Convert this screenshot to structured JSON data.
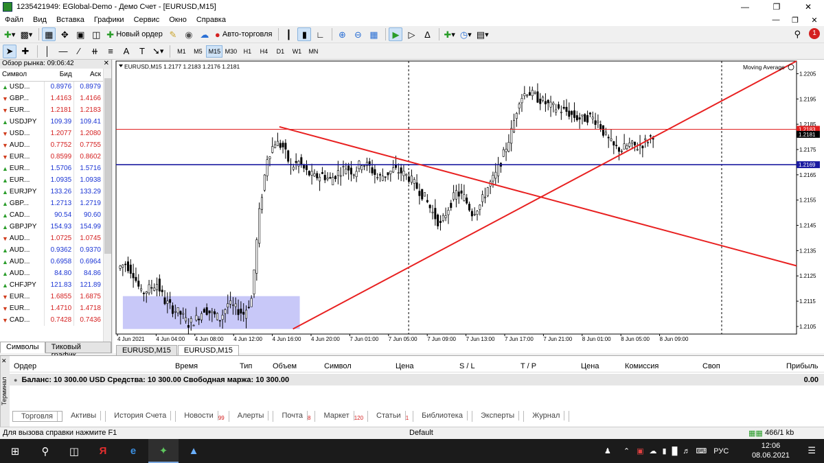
{
  "window": {
    "title": "1235421949: EGlobal-Demo - Демо Счет - [EURUSD,M15]"
  },
  "menu": [
    "Файл",
    "Вид",
    "Вставка",
    "Графики",
    "Сервис",
    "Окно",
    "Справка"
  ],
  "toolbar": {
    "new_order": "Новый ордер",
    "auto_trading": "Авто-торговля",
    "notification_count": "1"
  },
  "timeframes": [
    "M1",
    "M5",
    "M15",
    "M30",
    "H1",
    "H4",
    "D1",
    "W1",
    "MN"
  ],
  "active_timeframe": "M15",
  "market_watch": {
    "title": "Обзор рынка: 09:06:42",
    "columns": [
      "Символ",
      "Бид",
      "Аск"
    ],
    "rows": [
      {
        "symbol": "USD...",
        "bid": "0.8976",
        "ask": "0.8979",
        "dir": "up",
        "color": "blue"
      },
      {
        "symbol": "GBP...",
        "bid": "1.4163",
        "ask": "1.4166",
        "dir": "down",
        "color": "red"
      },
      {
        "symbol": "EUR...",
        "bid": "1.2181",
        "ask": "1.2183",
        "dir": "down",
        "color": "red"
      },
      {
        "symbol": "USDJPY",
        "bid": "109.39",
        "ask": "109.41",
        "dir": "up",
        "color": "blue"
      },
      {
        "symbol": "USD...",
        "bid": "1.2077",
        "ask": "1.2080",
        "dir": "down",
        "color": "red"
      },
      {
        "symbol": "AUD...",
        "bid": "0.7752",
        "ask": "0.7755",
        "dir": "down",
        "color": "red"
      },
      {
        "symbol": "EUR...",
        "bid": "0.8599",
        "ask": "0.8602",
        "dir": "down",
        "color": "red"
      },
      {
        "symbol": "EUR...",
        "bid": "1.5706",
        "ask": "1.5716",
        "dir": "up",
        "color": "blue"
      },
      {
        "symbol": "EUR...",
        "bid": "1.0935",
        "ask": "1.0938",
        "dir": "up",
        "color": "blue"
      },
      {
        "symbol": "EURJPY",
        "bid": "133.26",
        "ask": "133.29",
        "dir": "up",
        "color": "blue"
      },
      {
        "symbol": "GBP...",
        "bid": "1.2713",
        "ask": "1.2719",
        "dir": "up",
        "color": "blue"
      },
      {
        "symbol": "CAD...",
        "bid": "90.54",
        "ask": "90.60",
        "dir": "up",
        "color": "blue"
      },
      {
        "symbol": "GBPJPY",
        "bid": "154.93",
        "ask": "154.99",
        "dir": "up",
        "color": "blue"
      },
      {
        "symbol": "AUD...",
        "bid": "1.0725",
        "ask": "1.0745",
        "dir": "down",
        "color": "red"
      },
      {
        "symbol": "AUD...",
        "bid": "0.9362",
        "ask": "0.9370",
        "dir": "up",
        "color": "blue"
      },
      {
        "symbol": "AUD...",
        "bid": "0.6958",
        "ask": "0.6964",
        "dir": "up",
        "color": "blue"
      },
      {
        "symbol": "AUD...",
        "bid": "84.80",
        "ask": "84.86",
        "dir": "up",
        "color": "blue"
      },
      {
        "symbol": "CHFJPY",
        "bid": "121.83",
        "ask": "121.89",
        "dir": "up",
        "color": "blue"
      },
      {
        "symbol": "EUR...",
        "bid": "1.6855",
        "ask": "1.6875",
        "dir": "down",
        "color": "red"
      },
      {
        "symbol": "EUR...",
        "bid": "1.4710",
        "ask": "1.4718",
        "dir": "down",
        "color": "red"
      },
      {
        "symbol": "CAD...",
        "bid": "0.7428",
        "ask": "0.7436",
        "dir": "down",
        "color": "red"
      }
    ],
    "tabs": [
      "Символы",
      "Тиковый график"
    ],
    "active_tab": "Символы"
  },
  "chart": {
    "header": "EURUSD,M15  1.2177 1.2183 1.2176 1.2181",
    "indicator_label": "Moving Average",
    "tabs": [
      "EURUSD,M15",
      "EURUSD,M15"
    ],
    "active_tab_index": 1
  },
  "chart_data": {
    "type": "candlestick",
    "symbol": "EURUSD",
    "timeframe": "M15",
    "last_ohlc": {
      "open": 1.2177,
      "high": 1.2183,
      "low": 1.2176,
      "close": 1.2181
    },
    "y_ticks": [
      "1.2205",
      "1.2195",
      "1.2185",
      "1.2175",
      "1.2165",
      "1.2155",
      "1.2145",
      "1.2135",
      "1.2125",
      "1.2115",
      "1.2105"
    ],
    "ylim": [
      1.2102,
      1.221
    ],
    "x_ticks": [
      "4 Jun 2021",
      "4 Jun 04:00",
      "4 Jun 08:00",
      "4 Jun 12:00",
      "4 Jun 16:00",
      "4 Jun 20:00",
      "7 Jun 01:00",
      "7 Jun 05:00",
      "7 Jun 09:00",
      "7 Jun 13:00",
      "7 Jun 17:00",
      "7 Jun 21:00",
      "8 Jun 01:00",
      "8 Jun 05:00",
      "8 Jun 09:00"
    ],
    "price_labels": {
      "ask": "1.2183",
      "bid": "1.2181",
      "hline": "1.2169"
    },
    "horizontal_lines": [
      {
        "value": 1.2183,
        "color": "#e02020"
      },
      {
        "value": 1.2169,
        "color": "#1a1aa0"
      }
    ],
    "trendlines": [
      {
        "from": {
          "xi": 0.26,
          "y": 1.2104
        },
        "to": {
          "xi": 1.0,
          "y": 1.221
        },
        "color": "#e82020"
      },
      {
        "from": {
          "xi": 0.24,
          "y": 1.2184
        },
        "to": {
          "xi": 1.0,
          "y": 1.2129
        },
        "color": "#e82020"
      }
    ],
    "rectangle": {
      "x0": 0.01,
      "x1": 0.27,
      "y0": 1.2104,
      "y1": 1.2117,
      "color": "#c8c8f8"
    },
    "candles_path": [
      1.2128,
      1.213,
      1.2126,
      1.2118,
      1.212,
      1.2122,
      1.2115,
      1.2112,
      1.211,
      1.2106,
      1.2108,
      1.2112,
      1.211,
      1.2108,
      1.2114,
      1.2112,
      1.211,
      1.2116,
      1.215,
      1.2172,
      1.2178,
      1.2176,
      1.2168,
      1.217,
      1.2166,
      1.2164,
      1.2165,
      1.2163,
      1.2166,
      1.2168,
      1.2166,
      1.217,
      1.2168,
      1.2164,
      1.2165,
      1.2167,
      1.2166,
      1.2164,
      1.216,
      1.2156,
      1.215,
      1.2145,
      1.2152,
      1.2158,
      1.2156,
      1.215,
      1.2153,
      1.216,
      1.2165,
      1.2173,
      1.2182,
      1.2195,
      1.2198,
      1.2196,
      1.2194,
      1.2192,
      1.2191,
      1.219,
      1.2188,
      1.2187,
      1.2188,
      1.2186,
      1.218,
      1.2176,
      1.2175,
      1.2177,
      1.2176,
      1.2178,
      1.2181
    ]
  },
  "terminal": {
    "label": "Терминал",
    "columns": [
      "Ордер",
      "Время",
      "Тип",
      "Объем",
      "Символ",
      "Цена",
      "S / L",
      "T / P",
      "Цена",
      "Комиссия",
      "Своп",
      "Прибыль"
    ],
    "balance_line": "Баланс: 10 300.00 USD  Средства: 10 300.00  Свободная маржа: 10 300.00",
    "profit": "0.00",
    "tabs": [
      {
        "label": "Торговля",
        "badge": ""
      },
      {
        "label": "Активы",
        "badge": ""
      },
      {
        "label": "История Счета",
        "badge": ""
      },
      {
        "label": "Новости",
        "badge": "99"
      },
      {
        "label": "Алерты",
        "badge": ""
      },
      {
        "label": "Почта",
        "badge": "8"
      },
      {
        "label": "Маркет",
        "badge": "120"
      },
      {
        "label": "Статьи",
        "badge": "1"
      },
      {
        "label": "Библиотека",
        "badge": ""
      },
      {
        "label": "Эксперты",
        "badge": ""
      },
      {
        "label": "Журнал",
        "badge": ""
      }
    ]
  },
  "status": {
    "help": "Для вызова справки нажмите F1",
    "profile": "Default",
    "traffic": "466/1 kb"
  },
  "taskbar": {
    "lang": "РУС",
    "time": "12:06",
    "date": "08.06.2021"
  }
}
